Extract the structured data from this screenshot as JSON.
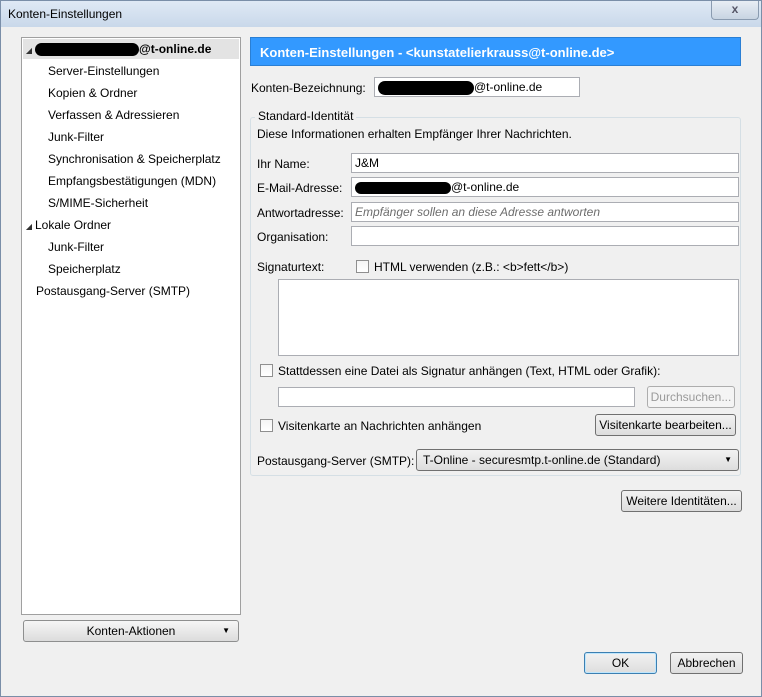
{
  "window": {
    "title": "Konten-Einstellungen",
    "close": "x"
  },
  "tree": {
    "account": {
      "suffix": "@t-online.de"
    },
    "items": [
      {
        "label": "Server-Einstellungen"
      },
      {
        "label": "Kopien & Ordner"
      },
      {
        "label": "Verfassen & Adressieren"
      },
      {
        "label": "Junk-Filter"
      },
      {
        "label": "Synchronisation & Speicherplatz"
      },
      {
        "label": "Empfangsbestätigungen (MDN)"
      },
      {
        "label": "S/MIME-Sicherheit"
      }
    ],
    "local": {
      "label": "Lokale Ordner"
    },
    "local_items": [
      {
        "label": "Junk-Filter"
      },
      {
        "label": "Speicherplatz"
      }
    ],
    "smtp": {
      "label": "Postausgang-Server (SMTP)"
    }
  },
  "actions": {
    "label": "Konten-Aktionen"
  },
  "header": {
    "title": "Konten-Einstellungen - <kunstatelierkrauss@t-online.de>"
  },
  "form": {
    "account_name_label": "Konten-Bezeichnung:",
    "account_name_suffix": "@t-online.de",
    "identity_group": "Standard-Identität",
    "identity_desc": "Diese Informationen erhalten Empfänger Ihrer Nachrichten.",
    "name_label": "Ihr Name:",
    "name_value": "J&M",
    "email_label": "E-Mail-Adresse:",
    "email_suffix": "@t-online.de",
    "reply_label": "Antwortadresse:",
    "reply_placeholder": "Empfänger sollen an diese Adresse antworten",
    "org_label": "Organisation:",
    "sig_label": "Signaturtext:",
    "html_label": "HTML verwenden (z.B.: <b>fett</b>)",
    "attach_file_label": "Stattdessen eine Datei als Signatur anhängen (Text, HTML oder Grafik):",
    "browse_label": "Durchsuchen...",
    "vcard_label": "Visitenkarte an Nachrichten anhängen",
    "vcard_edit_label": "Visitenkarte bearbeiten...",
    "smtp_label": "Postausgang-Server (SMTP):",
    "smtp_value": "T-Online - securesmtp.t-online.de (Standard)",
    "more_identities_label": "Weitere Identitäten..."
  },
  "dialog": {
    "ok_label": "OK",
    "cancel_label": "Abbrechen"
  }
}
